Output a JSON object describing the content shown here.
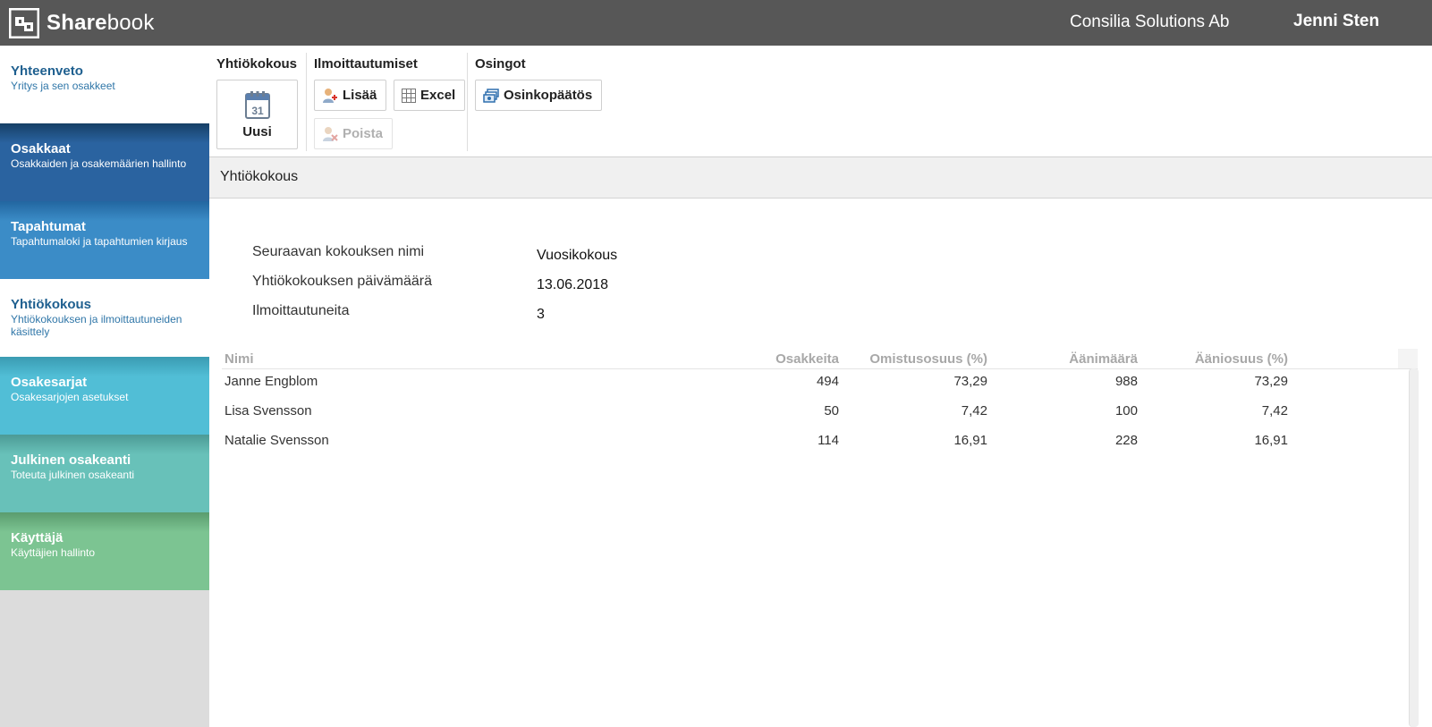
{
  "header": {
    "logo_bold": "Share",
    "logo_light": "book",
    "company": "Consilia Solutions Ab",
    "user": "Jenni Sten"
  },
  "sidebar": {
    "items": [
      {
        "title": "Yhteenveto",
        "subtitle": "Yritys ja sen osakkeet"
      },
      {
        "title": "Osakkaat",
        "subtitle": "Osakkaiden ja osakemäärien hallinto"
      },
      {
        "title": "Tapahtumat",
        "subtitle": "Tapahtumaloki ja tapahtumien kirjaus"
      },
      {
        "title": "Yhtiökokous",
        "subtitle": "Yhtiökokouksen ja ilmoittautuneiden käsittely"
      },
      {
        "title": "Osakesarjat",
        "subtitle": "Osakesarjojen asetukset"
      },
      {
        "title": "Julkinen osakeanti",
        "subtitle": "Toteuta julkinen osakeanti"
      },
      {
        "title": "Käyttäjä",
        "subtitle": "Käyttäjien hallinto"
      }
    ]
  },
  "toolbar": {
    "group1_title": "Yhtiökokous",
    "new_label": "Uusi",
    "calendar_day": "31",
    "group2_title": "Ilmoittautumiset",
    "add_label": "Lisää",
    "excel_label": "Excel",
    "remove_label": "Poista",
    "group3_title": "Osingot",
    "dividend_label": "Osinkopäätös"
  },
  "section": {
    "title": "Yhtiökokous"
  },
  "meeting": {
    "name_label": "Seuraavan kokouksen nimi",
    "name_value": "Vuosikokous",
    "date_label": "Yhtiökokouksen päivämäärä",
    "date_value": "13.06.2018",
    "registered_label": "Ilmoittautuneita",
    "registered_value": "3"
  },
  "table": {
    "columns": [
      "Nimi",
      "Osakkeita",
      "Omistusosuus (%)",
      "Äänimäärä",
      "Ääniosuus (%)"
    ],
    "rows": [
      [
        "Janne Engblom",
        "494",
        "73,29",
        "988",
        "73,29"
      ],
      [
        "Lisa Svensson",
        "50",
        "7,42",
        "100",
        "7,42"
      ],
      [
        "Natalie Svensson",
        "114",
        "16,91",
        "228",
        "16,91"
      ]
    ]
  },
  "icons": {
    "logo": "sharebook-logo-icon",
    "calendar": "calendar-icon",
    "add_user": "add-user-icon",
    "excel": "table-grid-icon",
    "remove_user": "remove-user-icon",
    "dividend": "money-icon"
  },
  "colors": {
    "topbar": "#575757",
    "nav_osakkaat": "#2a63a0",
    "nav_tapahtumat": "#3b8cc7",
    "nav_osakesarjat": "#51bed6",
    "nav_julkinen": "#68c1b9",
    "nav_kayttaja": "#7cc492",
    "active_text": "#1e5f8f"
  }
}
